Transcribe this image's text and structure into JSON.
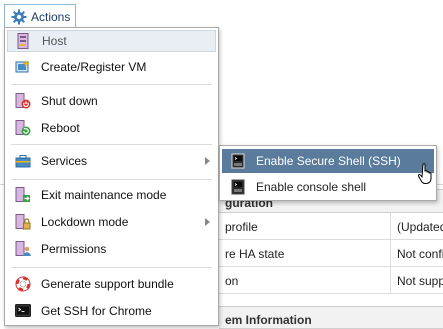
{
  "actions": {
    "label": "Actions"
  },
  "menu": {
    "header": "Host",
    "items": [
      {
        "label": "Create/Register VM",
        "icon": "create-register-vm-icon"
      },
      {
        "label": "Shut down",
        "icon": "shut-down-icon"
      },
      {
        "label": "Reboot",
        "icon": "reboot-icon"
      },
      {
        "label": "Services",
        "icon": "services-icon",
        "has_submenu": true
      },
      {
        "label": "Exit maintenance mode",
        "icon": "exit-maintenance-icon"
      },
      {
        "label": "Lockdown mode",
        "icon": "lockdown-icon",
        "has_submenu": true
      },
      {
        "label": "Permissions",
        "icon": "permissions-icon"
      },
      {
        "label": "Generate support bundle",
        "icon": "support-bundle-icon"
      },
      {
        "label": "Get SSH for Chrome",
        "icon": "ssh-chrome-icon"
      }
    ]
  },
  "submenu": {
    "items": [
      {
        "label": "Enable Secure Shell (SSH)",
        "icon": "ssh-terminal-icon",
        "highlighted": true
      },
      {
        "label": "Enable console shell",
        "icon": "console-terminal-icon"
      }
    ]
  },
  "background": {
    "config_header": "guration",
    "rows": [
      {
        "col1": "profile",
        "col2": "(Updated"
      },
      {
        "col1": "re HA state",
        "col2": "Not confi"
      },
      {
        "col1": "on",
        "col2": "Not supp"
      }
    ],
    "system_header": "em Information"
  },
  "colors": {
    "highlight": "#5a7b9c",
    "menu_header_bg": "#e8eef4",
    "actions_text": "#1f3f66"
  }
}
